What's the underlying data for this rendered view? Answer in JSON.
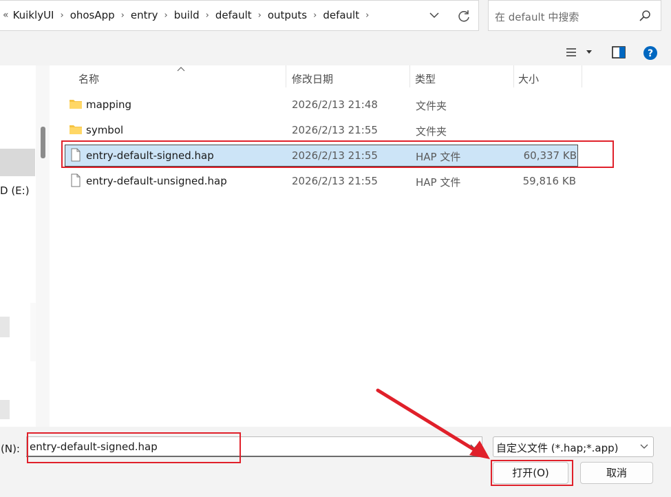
{
  "breadcrumbs": [
    "KuiklyUI",
    "ohosApp",
    "entry",
    "build",
    "default",
    "outputs",
    "default"
  ],
  "breadcrumb_overflow": "«",
  "search": {
    "placeholder": "在 default 中搜索"
  },
  "columns": {
    "name": "名称",
    "date": "修改日期",
    "type": "类型",
    "size": "大小"
  },
  "sidebar": {
    "drive_label": "D (E:)"
  },
  "files": [
    {
      "name": "mapping",
      "date": "2026/2/13 21:48",
      "type": "文件夹",
      "size": "",
      "icon": "folder-icon",
      "selected": false
    },
    {
      "name": "symbol",
      "date": "2026/2/13 21:55",
      "type": "文件夹",
      "size": "",
      "icon": "folder-icon",
      "selected": false
    },
    {
      "name": "entry-default-signed.hap",
      "date": "2026/2/13 21:55",
      "type": "HAP 文件",
      "size": "60,337 KB",
      "icon": "file-icon",
      "selected": true
    },
    {
      "name": "entry-default-unsigned.hap",
      "date": "2026/2/13 21:55",
      "type": "HAP 文件",
      "size": "59,816 KB",
      "icon": "file-icon",
      "selected": false
    }
  ],
  "footer": {
    "filename_label": "名(N):",
    "filename_value": "entry-default-signed.hap",
    "filter_value": "自定义文件 (*.hap;*.app)",
    "open_label": "打开(O)",
    "cancel_label": "取消"
  },
  "colors": {
    "selection": "#cce4f7",
    "annotation_red": "#e0202a",
    "help_blue": "#0067c0"
  }
}
